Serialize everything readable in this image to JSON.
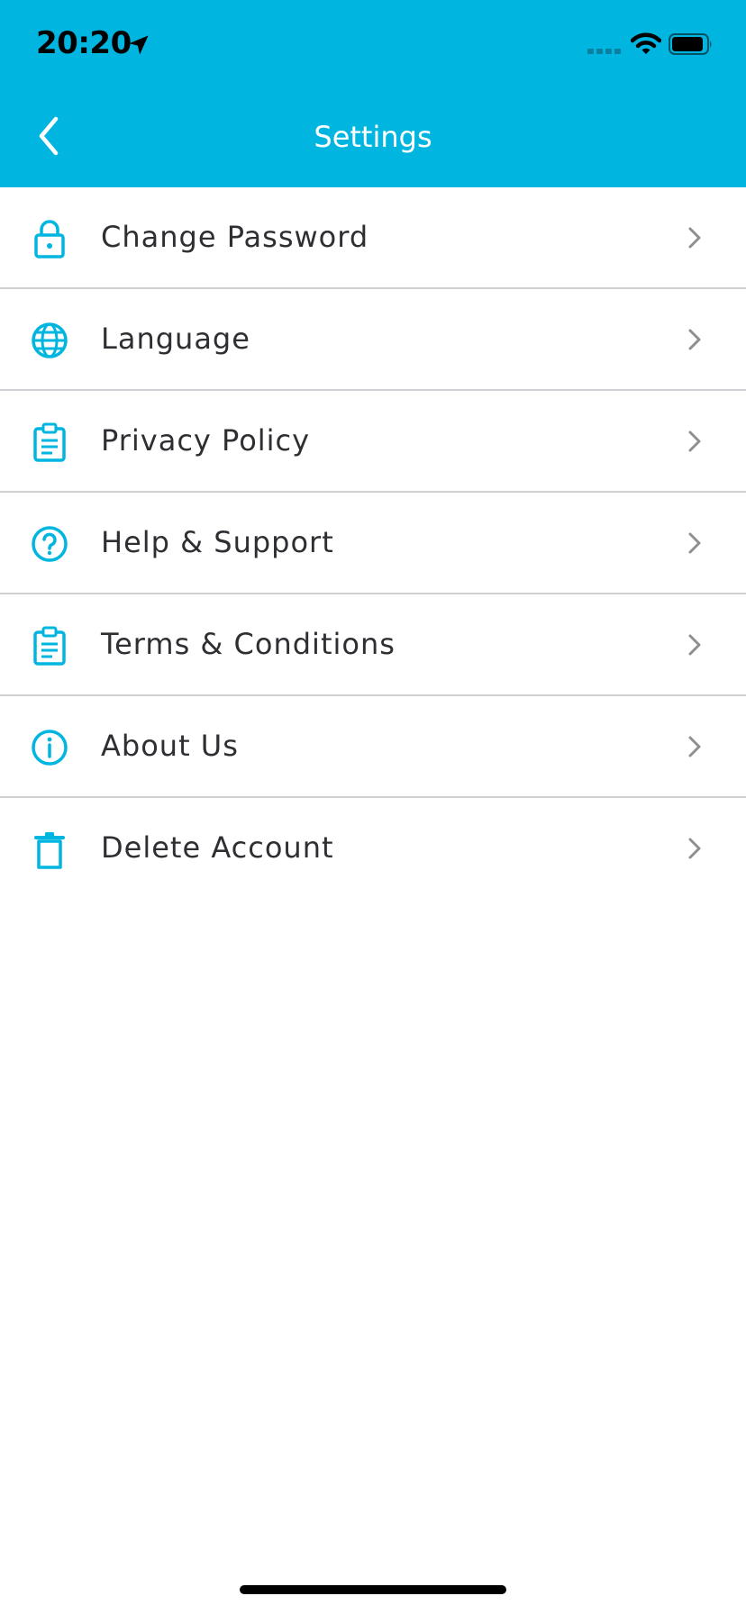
{
  "status_bar": {
    "time": "20:20"
  },
  "header": {
    "title": "Settings",
    "color": "#00b6e0"
  },
  "menu": {
    "items": [
      {
        "label": "Change Password",
        "icon": "lock-icon"
      },
      {
        "label": "Language",
        "icon": "globe-icon"
      },
      {
        "label": "Privacy Policy",
        "icon": "clipboard-icon"
      },
      {
        "label": "Help & Support",
        "icon": "help-circle-icon"
      },
      {
        "label": "Terms & Conditions",
        "icon": "clipboard-icon"
      },
      {
        "label": "About Us",
        "icon": "info-circle-icon"
      },
      {
        "label": "Delete Account",
        "icon": "trash-icon"
      }
    ]
  },
  "colors": {
    "accent": "#00b6e0",
    "text": "#2e2e33",
    "divider": "#cfcfd4",
    "chevron": "#8e8e93"
  }
}
